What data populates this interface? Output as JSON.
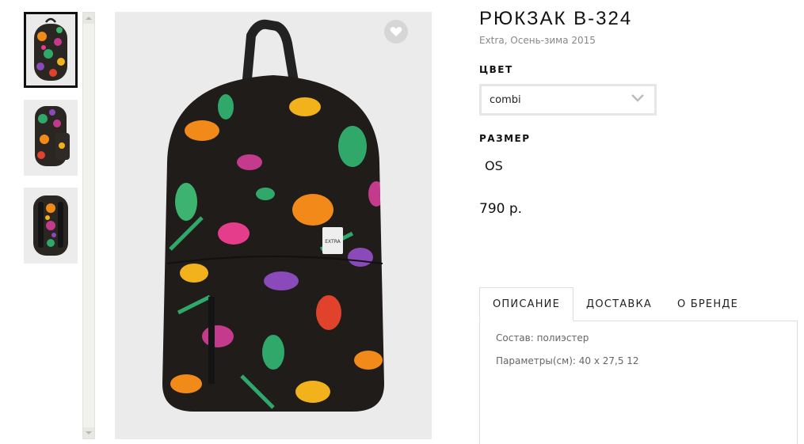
{
  "gallery": {
    "thumbnails": [
      {
        "alt": "front view",
        "active": true
      },
      {
        "alt": "side view",
        "active": false
      },
      {
        "alt": "back view",
        "active": false
      }
    ]
  },
  "icons": {
    "favorite": "heart-icon",
    "select": "chevron-down-icon",
    "scroll_up": "arrow-up-icon",
    "scroll_down": "arrow-down-icon"
  },
  "product": {
    "title": "РЮКЗАК B-324",
    "subtitle": "Extra, Осень-зима 2015",
    "brand_tag": "EXTRA",
    "color_label": "ЦВЕТ",
    "color_value": "combi",
    "size_label": "РАЗМЕР",
    "size_value": "OS",
    "price": "790 р."
  },
  "tabs": [
    {
      "label": "ОПИСАНИЕ",
      "active": true
    },
    {
      "label": "ДОСТАВКА",
      "active": false
    },
    {
      "label": "О БРЕНДЕ",
      "active": false
    }
  ],
  "description": {
    "composition": "Состав: полиэстер",
    "dimensions": "Параметры(см): 40 x 27,5 12"
  },
  "colors": {
    "background": "#ffffff",
    "image_bg": "#ebebeb",
    "select_border": "#e6e6e6",
    "tab_border": "#dddddd",
    "text_dark": "#111111",
    "text_muted": "#888888"
  }
}
